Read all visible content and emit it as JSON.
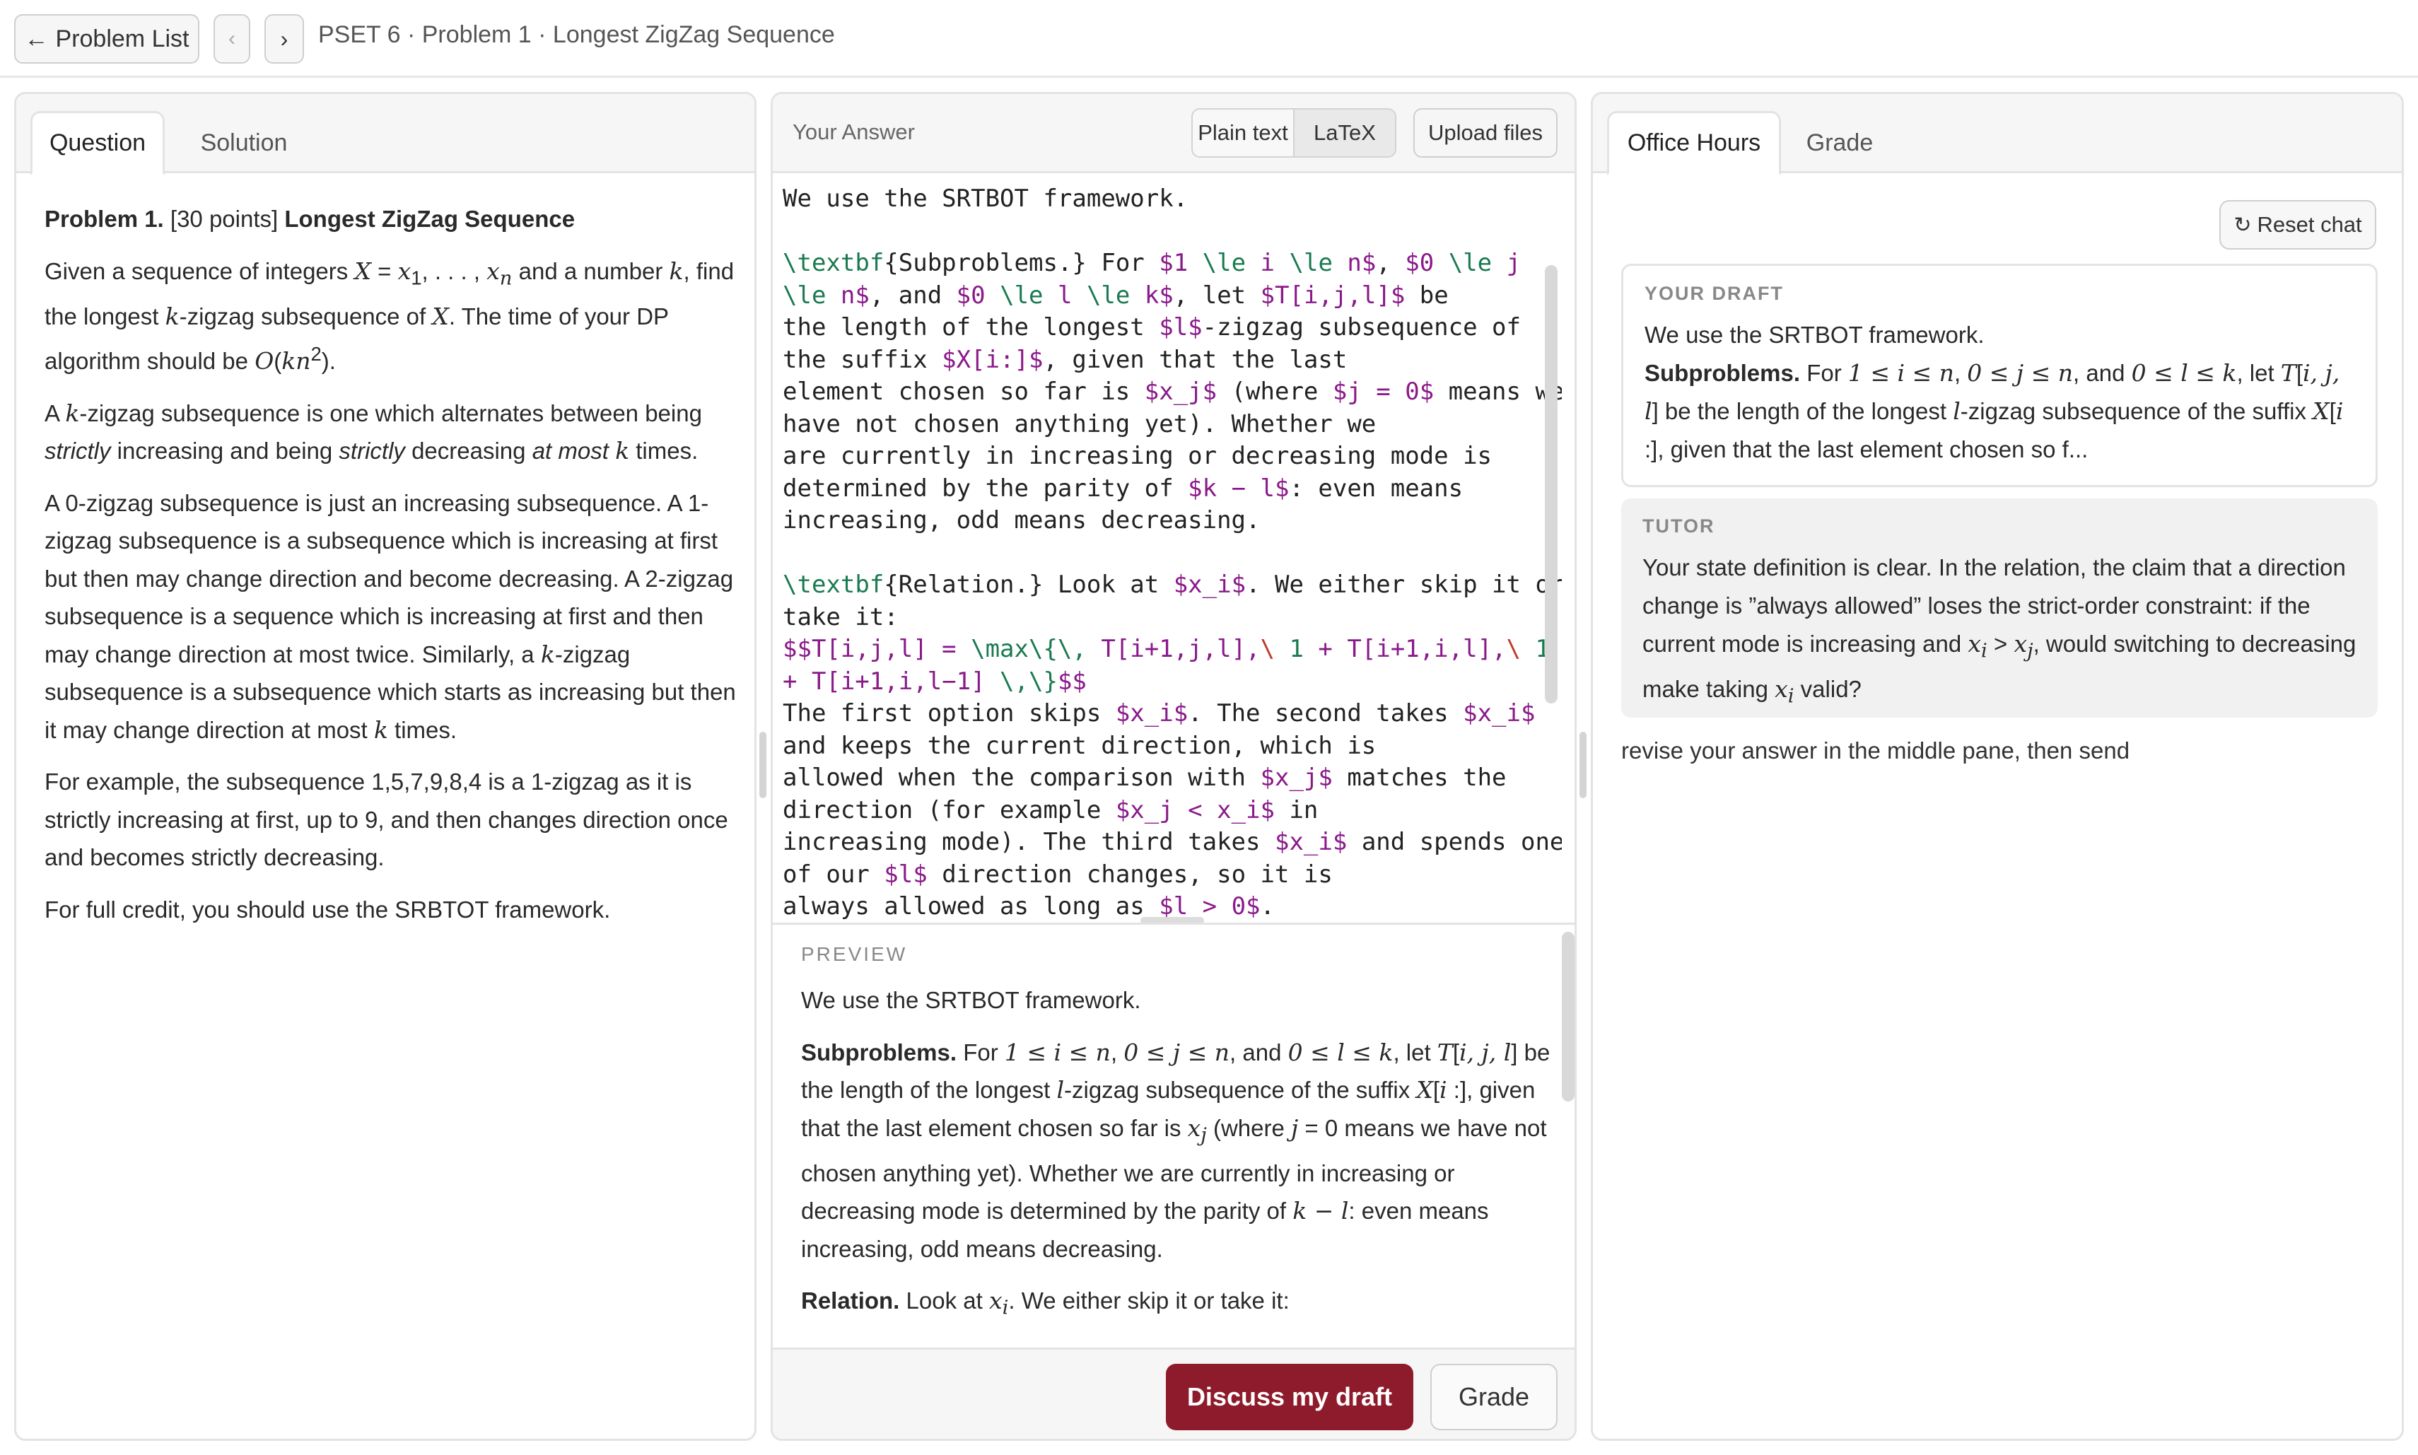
{
  "topbar": {
    "back_label": "Problem List",
    "prev_glyph": "‹",
    "next_glyph": "›",
    "breadcrumb": "PSET 6 · Problem 1 · Longest ZigZag Sequence"
  },
  "left": {
    "tabs": [
      "Question",
      "Solution"
    ],
    "problem_label": "Problem 1.",
    "points": "[30 points]",
    "problem_title": "Longest ZigZag Sequence"
  },
  "middle": {
    "answer_label": "Your Answer",
    "modes": [
      "Plain text",
      "LaTeX"
    ],
    "selected_mode": "LaTeX",
    "upload_label": "Upload files",
    "preview_label": "PREVIEW",
    "discuss_label": "Discuss my draft",
    "grade_label": "Grade"
  },
  "right": {
    "tabs": [
      "Office Hours",
      "Grade"
    ],
    "reset_label": "Reset chat",
    "draft_label": "YOUR DRAFT",
    "draft_line1": "We use the SRTBOT framework.",
    "tutor_label": "TUTOR",
    "hint": "revise your answer in the middle pane, then send"
  },
  "colors": {
    "accent": "#8e1b2b",
    "latex_command": "#1a7a50",
    "latex_math": "#8a1a8a"
  },
  "icons": {
    "back": "arrow-left-icon",
    "reset": "refresh-icon"
  }
}
